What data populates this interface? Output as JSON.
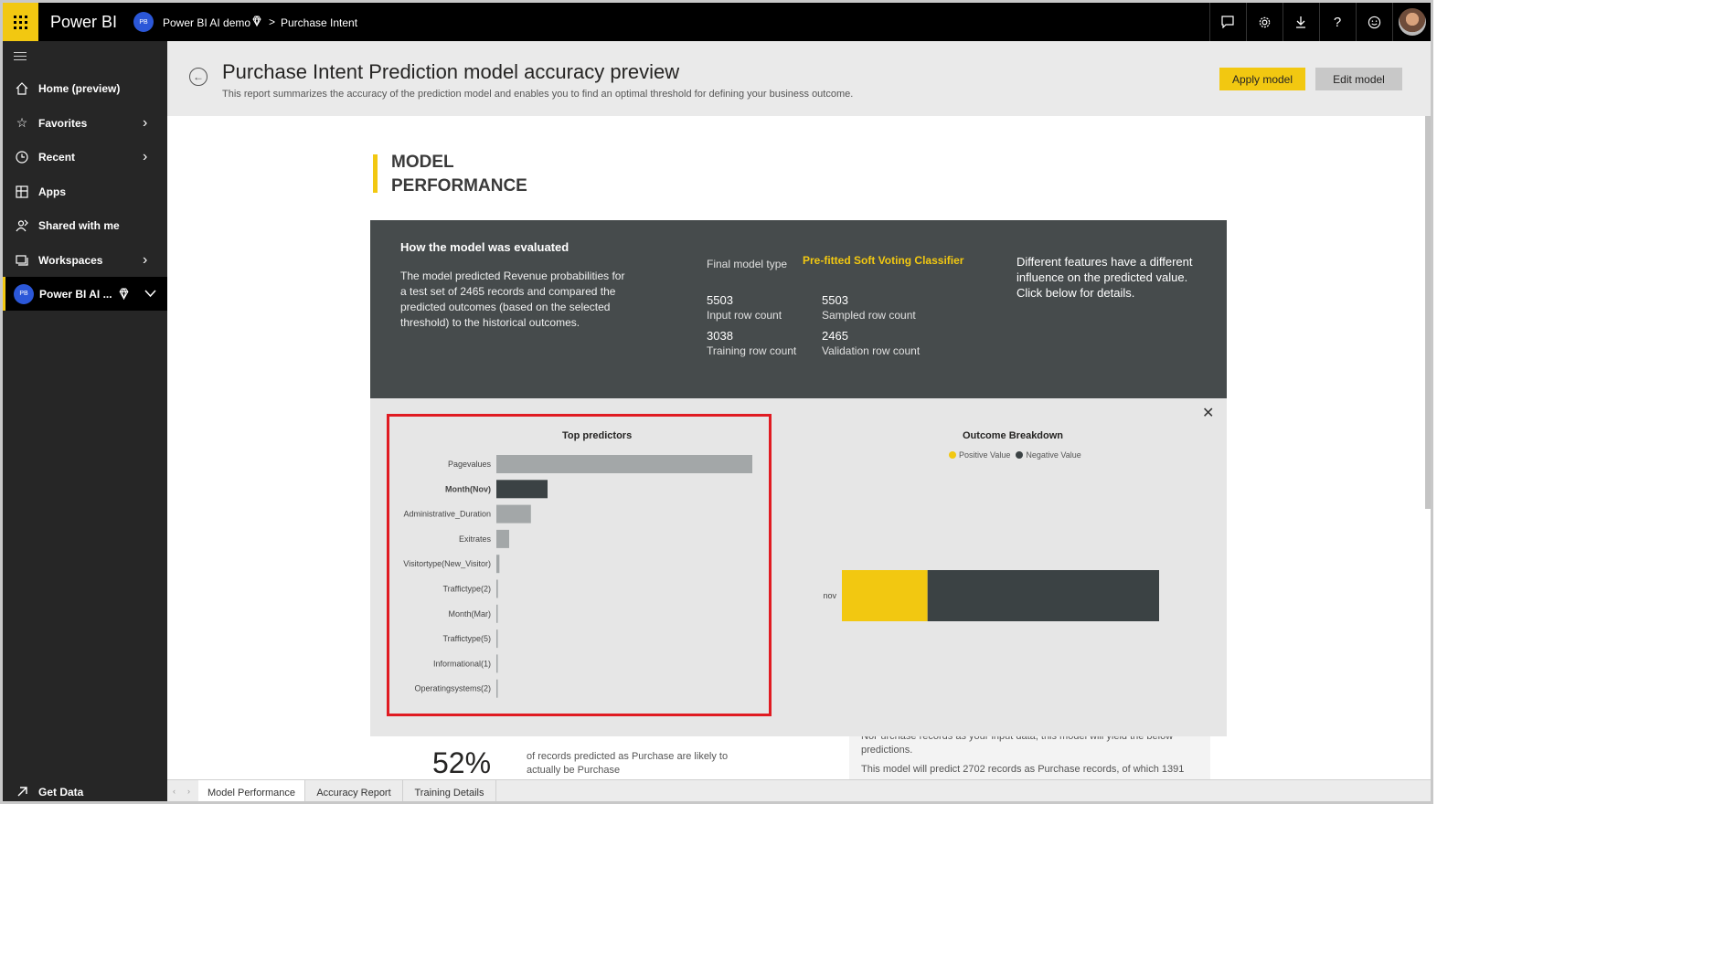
{
  "topbar": {
    "brand": "Power BI",
    "workspace_initials": "PB",
    "workspace": "Power BI AI demo",
    "separator": ">",
    "report": "Purchase Intent"
  },
  "sidebar": {
    "items": [
      {
        "label": "Home (preview)",
        "icon": "home-icon"
      },
      {
        "label": "Favorites",
        "icon": "star-icon"
      },
      {
        "label": "Recent",
        "icon": "clock-icon"
      },
      {
        "label": "Apps",
        "icon": "apps-icon"
      },
      {
        "label": "Shared with me",
        "icon": "shared-icon"
      },
      {
        "label": "Workspaces",
        "icon": "workspaces-icon"
      }
    ],
    "active_workspace": {
      "initials": "PB",
      "label": "Power BI AI ..."
    },
    "get_data": "Get Data"
  },
  "header": {
    "title": "Purchase Intent Prediction model accuracy preview",
    "subtitle": "This report summarizes the accuracy of the prediction model and enables you to find an optimal threshold for defining your business outcome.",
    "apply_label": "Apply model",
    "edit_label": "Edit model"
  },
  "section": {
    "title_line1": "MODEL",
    "title_line2": "PERFORMANCE"
  },
  "evaluation": {
    "heading": "How the model was evaluated",
    "body": "The model predicted Revenue probabilities for a test set of 2465 records and compared the predicted outcomes (based on the selected threshold) to the historical outcomes.",
    "model_type_label": "Final model type",
    "model_type_value": "Pre-fitted Soft Voting Classifier",
    "input_count": "5503",
    "input_label": "Input row count",
    "sampled_count": "5503",
    "sampled_label": "Sampled row count",
    "training_count": "3038",
    "training_label": "Training row count",
    "validation_count": "2465",
    "validation_label": "Validation row count",
    "features_note": "Different features have  a different influence on the predicted value.  Click below for details."
  },
  "chart_data": [
    {
      "type": "bar",
      "title": "Top predictors",
      "orientation": "horizontal",
      "categories": [
        "Pagevalues",
        "Month(Nov)",
        "Administrative_Duration",
        "Exitrates",
        "Visitortype(New_Visitor)",
        "Traffictype(2)",
        "Month(Mar)",
        "Traffictype(5)",
        "Informational(1)",
        "Operatingsystems(2)"
      ],
      "values": [
        1.0,
        0.2,
        0.135,
        0.05,
        0.012,
        0.006,
        0.005,
        0.004,
        0.003,
        0.003
      ],
      "highlighted": "Month(Nov)",
      "colors": {
        "bar": "#a3a7a8",
        "highlight": "#3b4244"
      }
    },
    {
      "type": "bar",
      "title": "Outcome Breakdown",
      "orientation": "horizontal",
      "stacked": true,
      "categories": [
        "nov"
      ],
      "series": [
        {
          "name": "Positive Value",
          "values": [
            0.27
          ],
          "color": "#f2c811"
        },
        {
          "name": "Negative Value",
          "values": [
            0.73
          ],
          "color": "#3b4244"
        }
      ],
      "legend": "top-center"
    }
  ],
  "bottom": {
    "percent": "52%",
    "percent_text": "of records predicted as Purchase are likely to actually be Purchase",
    "right_line1": "NoPurchase records as your input data, this model will yield the below predictions.",
    "right_line2": "This model will predict 2702 records as Purchase records, of which 1391"
  },
  "tabs": [
    "Model Performance",
    "Accuracy Report",
    "Training Details"
  ],
  "colors": {
    "accent": "#f2c811",
    "highlight_box": "#e01b22",
    "dark_panel": "#464b4c"
  }
}
